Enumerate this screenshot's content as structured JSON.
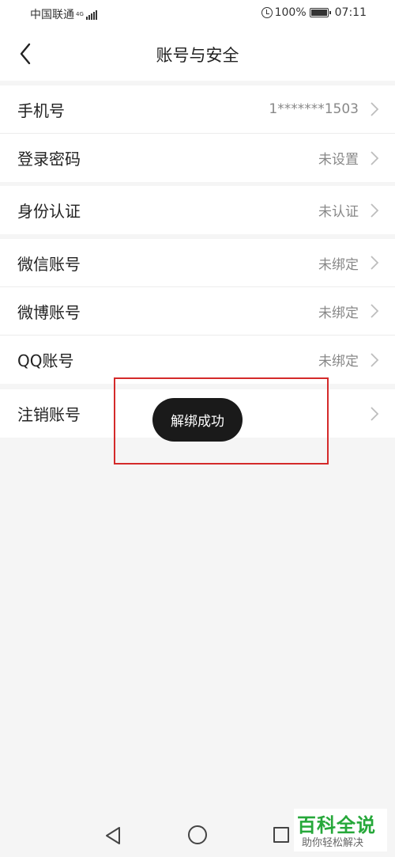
{
  "status_bar": {
    "carrier": "中国联通",
    "network": "4G",
    "battery": "100%",
    "time": "07:11"
  },
  "header": {
    "title": "账号与安全"
  },
  "groups": [
    {
      "rows": [
        {
          "label": "手机号",
          "value": "1*******1503"
        },
        {
          "label": "登录密码",
          "value": "未设置"
        }
      ]
    },
    {
      "rows": [
        {
          "label": "身份认证",
          "value": "未认证"
        }
      ]
    },
    {
      "rows": [
        {
          "label": "微信账号",
          "value": "未绑定"
        },
        {
          "label": "微博账号",
          "value": "未绑定"
        },
        {
          "label": "QQ账号",
          "value": "未绑定"
        }
      ]
    },
    {
      "rows": [
        {
          "label": "注销账号",
          "value": ""
        }
      ]
    }
  ],
  "toast": {
    "text": "解绑成功"
  },
  "watermark": {
    "main": "百科全说",
    "sub": "助你轻松解决"
  },
  "colors": {
    "highlight": "#d42a2a",
    "watermark_green": "#26a83a",
    "toast_bg": "#1a1a1a"
  }
}
